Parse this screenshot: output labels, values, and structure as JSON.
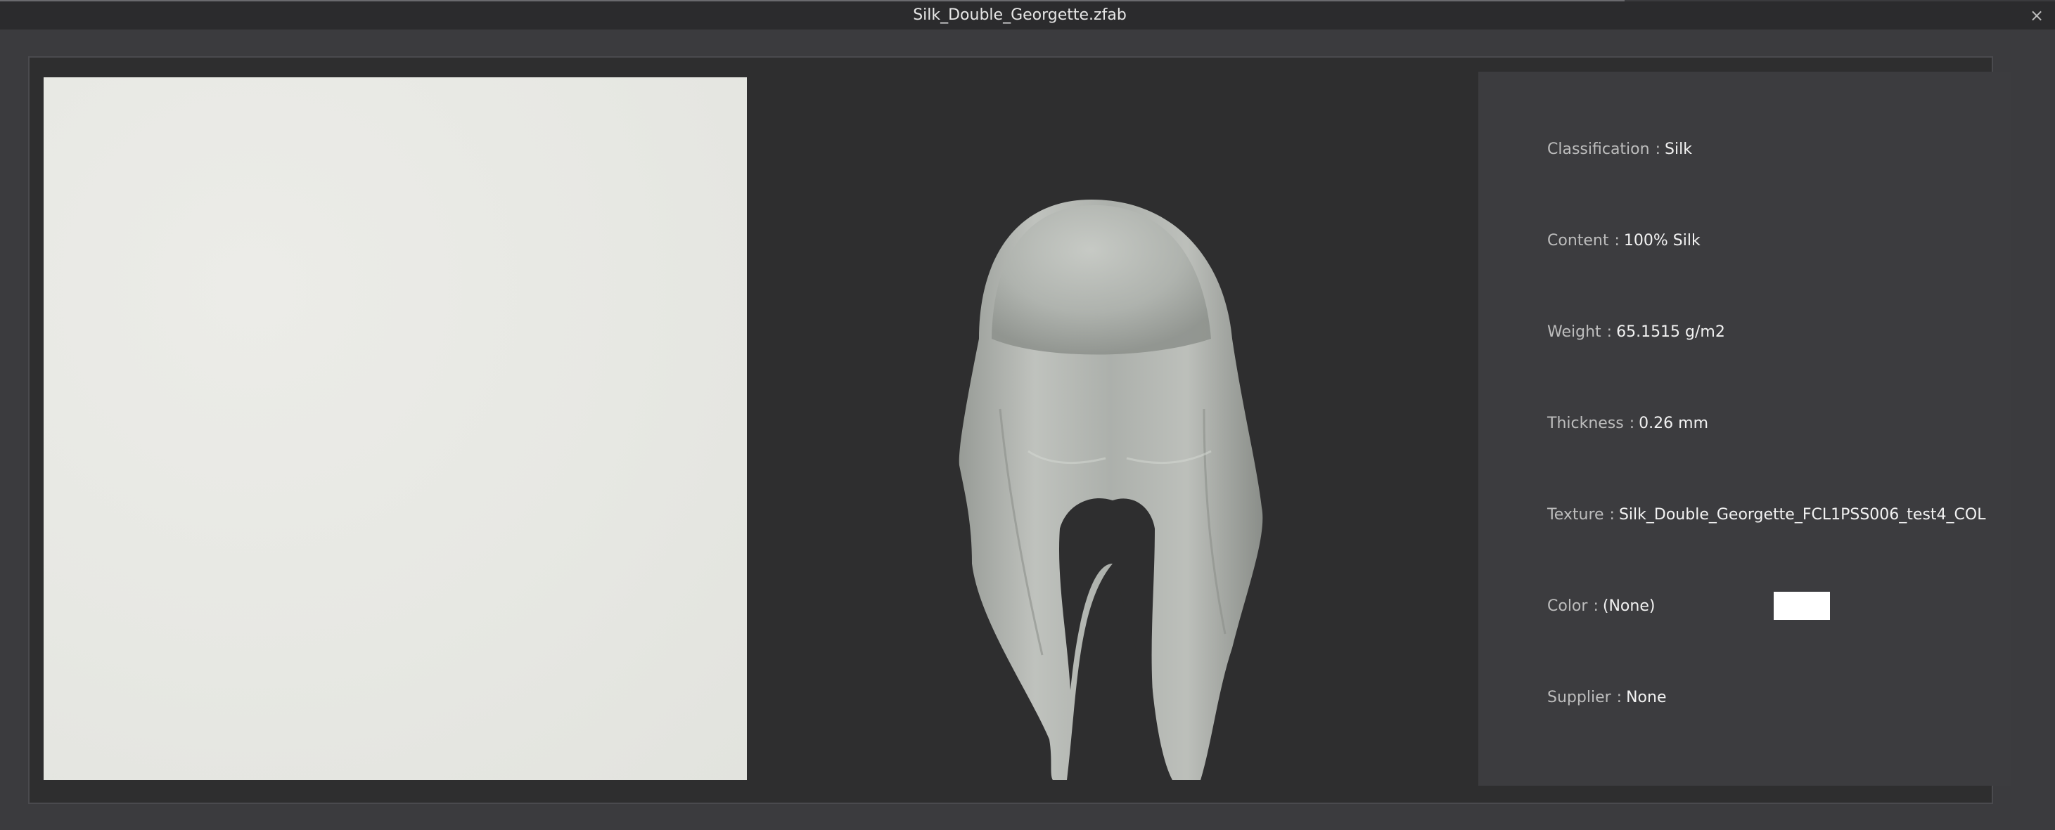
{
  "window": {
    "title": "Silk_Double_Georgette.zfab",
    "close_glyph": "×",
    "close_icon": "close-icon"
  },
  "properties": {
    "classification": {
      "label": "Classification",
      "value": "Silk"
    },
    "content": {
      "label": "Content",
      "value": "100% Silk"
    },
    "weight": {
      "label": "Weight",
      "value": "65.1515 g/m2"
    },
    "thickness": {
      "label": "Thickness",
      "value": "0.26 mm"
    },
    "texture": {
      "label": "Texture",
      "value": "Silk_Double_Georgette_FCL1PSS006_test4_COL"
    },
    "color": {
      "label": "Color",
      "value": "(None)",
      "swatch_hex": "#ffffff"
    },
    "supplier": {
      "label": "Supplier",
      "value": "None"
    }
  },
  "separator": ":",
  "colors": {
    "background": "#3b3b3e",
    "titlebar": "#2b2b2d",
    "viewer": "#2e2e2f",
    "panel": "#3c3c3f",
    "fabric": "#e6e7e2"
  }
}
